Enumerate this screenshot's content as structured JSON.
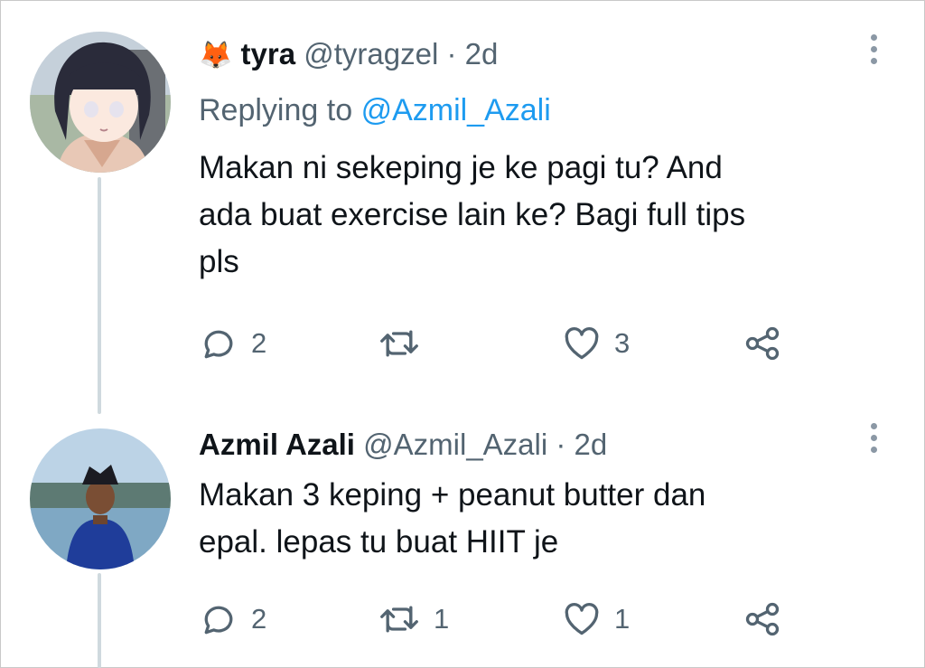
{
  "tweets": [
    {
      "name": "tyra",
      "emoji": "🦊",
      "handle": "@tyragzel",
      "dot": "·",
      "time": "2d",
      "replying_prefix": "Replying to",
      "replying_to": "@Azmil_Azali",
      "body": [
        "Makan ni sekeping je ke pagi tu? And",
        "ada buat exercise lain ke? Bagi full tips",
        "pls"
      ],
      "actions": {
        "reply": "2",
        "retweet": "",
        "like": "3"
      }
    },
    {
      "name": "Azmil Azali",
      "handle": "@Azmil_Azali",
      "dot": "·",
      "time": "2d",
      "body": [
        "Makan 3 keping + peanut butter dan",
        "epal. lepas tu buat HIIT je"
      ],
      "actions": {
        "reply": "2",
        "retweet": "1",
        "like": "1"
      }
    }
  ],
  "colors": {
    "text": "#0f1419",
    "muted": "#536471",
    "link": "#1d9bf0",
    "thread_line": "#cfd9de"
  },
  "icons": [
    "reply-icon",
    "retweet-icon",
    "like-icon",
    "share-icon",
    "more-icon"
  ]
}
